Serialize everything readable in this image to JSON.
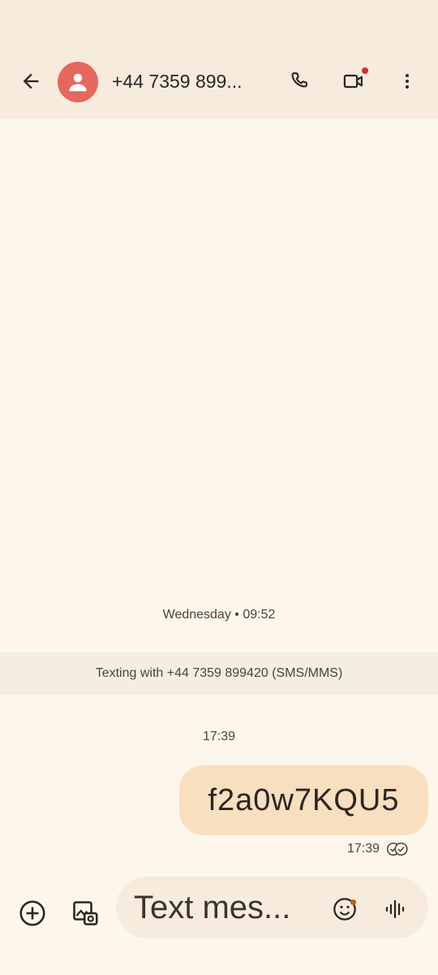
{
  "header": {
    "title": "+44 7359 899..."
  },
  "conversation": {
    "date_separator": "Wednesday • 09:52",
    "banner": "Texting with +44 7359 899420 (SMS/MMS)",
    "time_separator": "17:39",
    "messages": [
      {
        "direction": "outgoing",
        "text": "f2a0w7KQU5",
        "time": "17:39",
        "status": "delivered"
      }
    ]
  },
  "composer": {
    "placeholder": "Text mes..."
  },
  "icons": [
    "back-arrow-icon",
    "avatar-person-icon",
    "phone-icon",
    "video-call-icon",
    "more-vert-icon",
    "add-circle-icon",
    "gallery-icon",
    "emoji-icon",
    "voice-waveform-icon",
    "double-check-icon"
  ],
  "colors": {
    "background": "#fdf6ea",
    "appbar": "#f6ebdd",
    "avatar": "#e5685f",
    "outgoing_bubble": "#f8dfbf",
    "notification_dot": "#d32f2f"
  }
}
